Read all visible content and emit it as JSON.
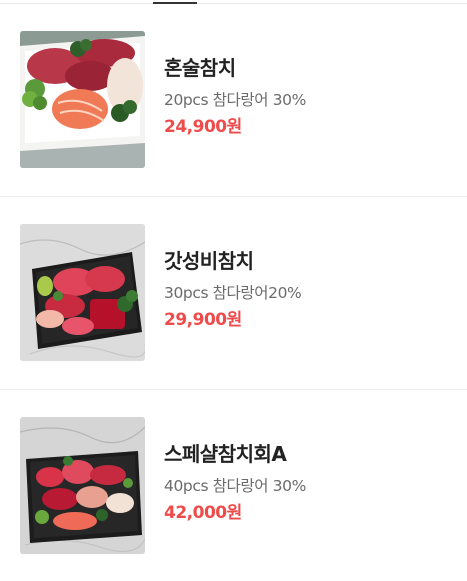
{
  "products": [
    {
      "name": "혼술참치",
      "description": "20pcs 참다랑어 30%",
      "price": "24,900원",
      "image": "tuna-platter-photo"
    },
    {
      "name": "갓성비참치",
      "description": "30pcs 참다랑어20%",
      "price": "29,900원",
      "image": "tuna-tray-photo"
    },
    {
      "name": "스페샬참치회A",
      "description": "40pcs 참다랑어 30%",
      "price": "42,000원",
      "image": "tuna-tray-special-photo"
    }
  ],
  "colors": {
    "price": "#ee4b4b",
    "name": "#222222",
    "description": "#6b6b6b",
    "divider": "#ececec"
  }
}
